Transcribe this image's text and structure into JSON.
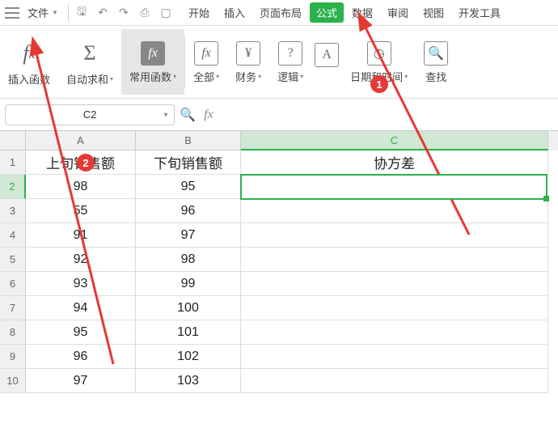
{
  "top": {
    "file": "文件",
    "tabs": [
      "开始",
      "插入",
      "页面布局",
      "公式",
      "数据",
      "审阅",
      "视图",
      "开发工具"
    ],
    "active_tab_index": 3
  },
  "ribbon": {
    "insert_fn": "插入函数",
    "autosum": "自动求和",
    "common_fn": "常用函数",
    "all": "全部",
    "finance": "财务",
    "logic": "逻辑",
    "datetime": "日期和时间",
    "find": "查找"
  },
  "formula_bar": {
    "name_box": "C2",
    "formula": ""
  },
  "sheet": {
    "columns": [
      "A",
      "B",
      "C"
    ],
    "selected_col": "C",
    "selected_row": 2,
    "header_row": {
      "A": "上旬销售额",
      "B": "下旬销售额",
      "C": "协方差"
    },
    "rows": [
      {
        "n": 2,
        "A": "98",
        "B": "95",
        "C": ""
      },
      {
        "n": 3,
        "A": "55",
        "B": "96",
        "C": ""
      },
      {
        "n": 4,
        "A": "91",
        "B": "97",
        "C": ""
      },
      {
        "n": 5,
        "A": "92",
        "B": "98",
        "C": ""
      },
      {
        "n": 6,
        "A": "93",
        "B": "99",
        "C": ""
      },
      {
        "n": 7,
        "A": "94",
        "B": "100",
        "C": ""
      },
      {
        "n": 8,
        "A": "95",
        "B": "101",
        "C": ""
      },
      {
        "n": 9,
        "A": "96",
        "B": "102",
        "C": ""
      },
      {
        "n": 10,
        "A": "97",
        "B": "103",
        "C": ""
      }
    ]
  },
  "annotations": {
    "badge1": "1",
    "badge2": "2",
    "arrow_color": "#e53935"
  }
}
